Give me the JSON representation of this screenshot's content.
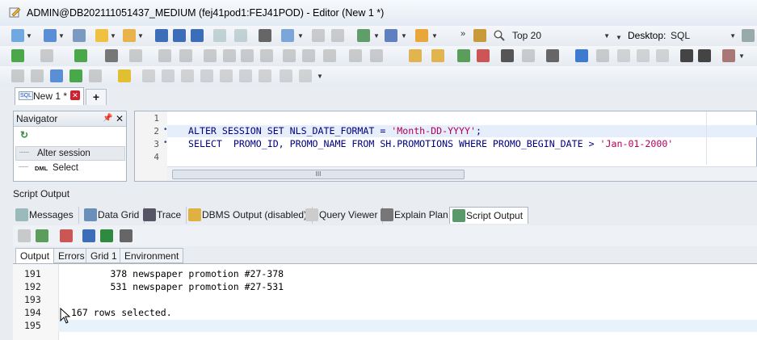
{
  "window": {
    "title": "ADMIN@DB202111051437_MEDIUM (fej41pod1:FEJ41POD) - Editor (New 1 *)"
  },
  "toolbar": {
    "rowcount_select": "Top 20",
    "desktop_label": "Desktop:",
    "desktop_select": "SQL"
  },
  "editor": {
    "tab_label": "New 1 *",
    "plus_label": "+",
    "line_numbers": [
      "1",
      "2",
      "3",
      "4"
    ],
    "line2_a": "ALTER SESSION SET NLS_DATE_FORMAT = ",
    "line2_b": "'Month-DD-YYYY'",
    "line2_c": ";",
    "line3_a": "SELECT  PROMO_ID, PROMO_NAME FROM SH.PROMOTIONS WHERE PROMO_BEGIN_DATE > ",
    "line3_b": "'Jan-01-2000'",
    "hscroll_label": "III"
  },
  "navigator": {
    "title": "Navigator",
    "pin": "✂",
    "close": "✕",
    "items": [
      {
        "prefix": "",
        "label": "Alter session"
      },
      {
        "prefix": "DML",
        "label": "Select"
      }
    ]
  },
  "script_output": {
    "title": "Script Output",
    "tabs": [
      "Messages",
      "Data Grid",
      "Trace",
      "DBMS Output (disabled)",
      "Query Viewer",
      "Explain Plan",
      "Script Output"
    ],
    "subtabs": [
      "Output",
      "Errors",
      "Grid 1",
      "Environment"
    ],
    "lines": [
      {
        "num": "191",
        "text": "       378 newspaper promotion #27-378"
      },
      {
        "num": "192",
        "text": "       531 newspaper promotion #27-531"
      },
      {
        "num": "193",
        "text": ""
      },
      {
        "num": "194",
        "text": "167 rows selected."
      },
      {
        "num": "195",
        "text": ""
      }
    ]
  },
  "colors": {
    "keyword": "#000080",
    "string": "#b0005a",
    "accent": "#3d7bd0"
  }
}
